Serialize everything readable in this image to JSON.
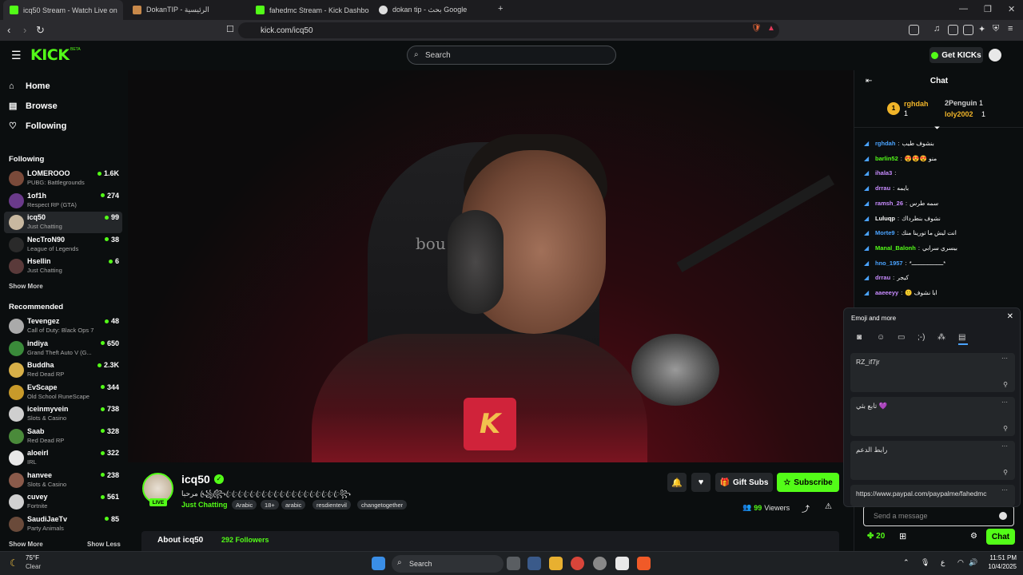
{
  "browser": {
    "tabs": [
      {
        "label": "icq50 Stream - Watch Live on",
        "active": true,
        "color": "#53fc18"
      },
      {
        "label": "DokanTIP - الرئيسية",
        "active": false,
        "color": "#c8894a"
      },
      {
        "label": "fahedmc Stream - Kick Dashboar",
        "active": false,
        "color": "#53fc18"
      },
      {
        "label": "dokan tip - بحث Google",
        "active": false,
        "color": "#dddddd"
      }
    ],
    "url": "kick.com/icq50"
  },
  "header": {
    "logo": "KICK",
    "logo_beta": "BETA",
    "search_placeholder": "Search",
    "get_kicks": "Get KICKs"
  },
  "sidebar": {
    "main": [
      {
        "label": "Home",
        "icon": "home-icon"
      },
      {
        "label": "Browse",
        "icon": "browse-icon"
      },
      {
        "label": "Following",
        "icon": "heart-icon"
      }
    ],
    "following_title": "Following",
    "following": [
      {
        "name": "LOMEROOO",
        "category": "PUBG: Battlegrounds",
        "viewers": "1.6K",
        "color": "#7a4a3a"
      },
      {
        "name": "1of1h",
        "category": "Respect RP (GTA)",
        "viewers": "274",
        "color": "#6a3a8a"
      },
      {
        "name": "icq50",
        "category": "Just Chatting",
        "viewers": "99",
        "color": "#c8b8a0"
      },
      {
        "name": "NecTroN90",
        "category": "League of Legends",
        "viewers": "38",
        "color": "#2a2a2a"
      },
      {
        "name": "Hsellin",
        "category": "Just Chatting",
        "viewers": "6",
        "color": "#5a3a3a"
      }
    ],
    "show_more_following": "Show More",
    "recommended_title": "Recommended",
    "recommended": [
      {
        "name": "Tevengez",
        "category": "Call of Duty: Black Ops 7",
        "viewers": "48",
        "color": "#aaaaaa"
      },
      {
        "name": "indiya",
        "category": "Grand Theft Auto V (G...",
        "viewers": "650",
        "color": "#3a8a3a"
      },
      {
        "name": "Buddha",
        "category": "Red Dead RP",
        "viewers": "2.3K",
        "color": "#d8b048"
      },
      {
        "name": "EvScape",
        "category": "Old School RuneScape",
        "viewers": "344",
        "color": "#c89a2a"
      },
      {
        "name": "iceinmyvein",
        "category": "Slots & Casino",
        "viewers": "738",
        "color": "#cfcfcf"
      },
      {
        "name": "Saab",
        "category": "Red Dead RP",
        "viewers": "328",
        "color": "#4a8a3a"
      },
      {
        "name": "aloeirl",
        "category": "IRL",
        "viewers": "322",
        "color": "#e8e8e8"
      },
      {
        "name": "hanvee",
        "category": "Slots & Casino",
        "viewers": "238",
        "color": "#8a5a4a"
      },
      {
        "name": "cuvey",
        "category": "Fortnite",
        "viewers": "561",
        "color": "#d0d0d0"
      },
      {
        "name": "SaudiJaeTv",
        "category": "Party Animals",
        "viewers": "85",
        "color": "#6a4a3a"
      }
    ],
    "show_more_recommended": "Show More",
    "show_less": "Show Less"
  },
  "video": {
    "wall_text": "bou",
    "shirt_logo": "K"
  },
  "stream": {
    "name": "icq50",
    "title": "مرحبا ꧁ꦿ꧂ꦿꦿꦿꦿꦿꦿꦿꦿꦿꦿꦿꦿꦿꦿꦿꦿꦿꦿꦿꦿ꧂",
    "category": "Just Chatting",
    "live": "LIVE",
    "tags": [
      "Arabic",
      "18+",
      "arabic",
      "resdientevil",
      "changetogether"
    ],
    "gift_subs": "Gift Subs",
    "subscribe": "Subscribe",
    "viewers_count": "99",
    "viewers_label": "Viewers",
    "about_title": "About icq50",
    "followers": "292 Followers"
  },
  "chat": {
    "title": "Chat",
    "leaderboard": [
      {
        "name": "rghdah",
        "count": "1",
        "color": "#f0b429"
      },
      {
        "name": "2Penguin",
        "count": "1",
        "color": "#cfcfcf"
      },
      {
        "name": "loly2002",
        "count": "1",
        "color": "#f0b429"
      }
    ],
    "messages": [
      {
        "user": "rghdah",
        "text": "بنشوف طيب",
        "color": "#4aa3ff"
      },
      {
        "user": "barlin52",
        "text": "😍😍😍 منو",
        "color": "#53fc18"
      },
      {
        "user": "ihala3",
        "text": "",
        "color": "#c88cff"
      },
      {
        "user": "drrau",
        "text": "بايمه",
        "color": "#c88cff"
      },
      {
        "user": "ramsh_26",
        "text": "سمه طرس",
        "color": "#c88cff"
      },
      {
        "user": "Luluqp",
        "text": "نشوف بنطرداك",
        "color": "#ffffff"
      },
      {
        "user": "Morte9",
        "text": "انت ليش ما تورينا منك",
        "color": "#4aa3ff"
      },
      {
        "user": "Manal_Balonh",
        "text": "بيسري سرابي",
        "color": "#53fc18"
      },
      {
        "user": "hno_1957",
        "text": "*ــــــــــــــــــ*",
        "color": "#4aa3ff"
      },
      {
        "user": "drrau",
        "text": "كيجر",
        "color": "#c88cff"
      },
      {
        "user": "aaeeeyy",
        "text": "🙂 ابا نشوف",
        "color": "#c88cff"
      }
    ],
    "emoji_panel": {
      "title": "Emoji and more",
      "quick_messages": [
        "RZ_if7jr",
        "تابع بثي 💜",
        "رابط الدعم",
        "https://www.paypal.com/paypalme/fahedmc"
      ]
    },
    "input_placeholder": "Send a message",
    "kicks_count": "20",
    "send_label": "Chat"
  },
  "taskbar": {
    "weather_temp": "75°F",
    "weather_desc": "Clear",
    "search": "Search",
    "time": "11:51 PM",
    "date": "10/4/2025"
  }
}
